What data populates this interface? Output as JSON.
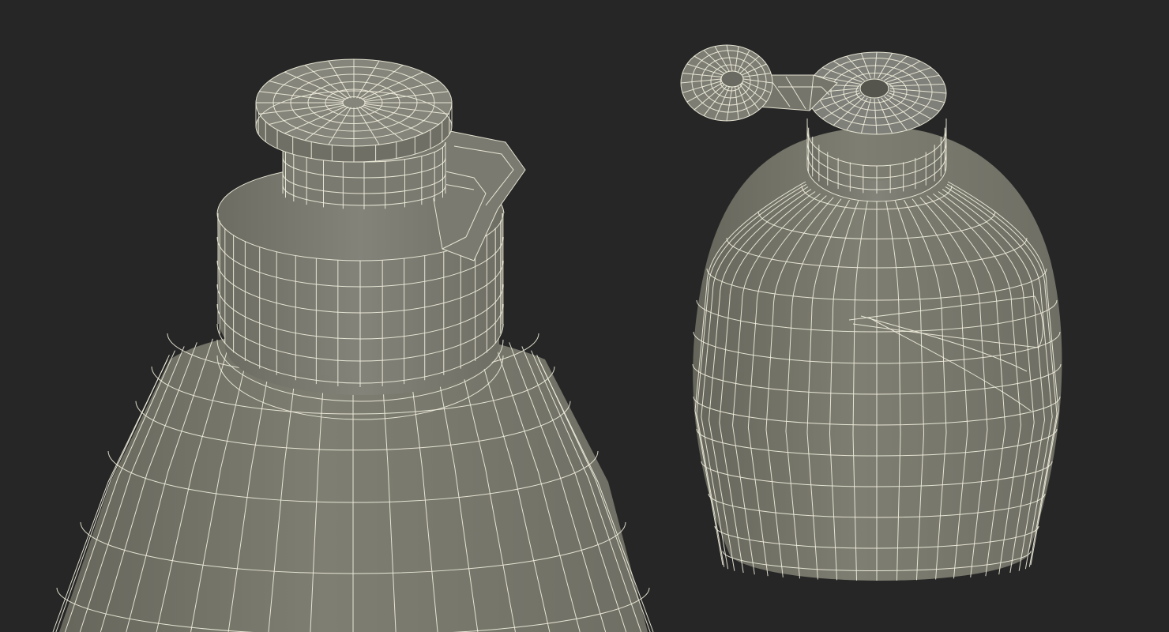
{
  "scene": {
    "background_color": "#262626",
    "surface_color": "#7b7b6f",
    "surface_shadow_color": "#5e5e55",
    "wire_color": "#f2f0de",
    "views": [
      {
        "name": "bottle-closeup-with-flip-cap-closed"
      },
      {
        "name": "bottle-with-flip-cap-open"
      }
    ]
  }
}
